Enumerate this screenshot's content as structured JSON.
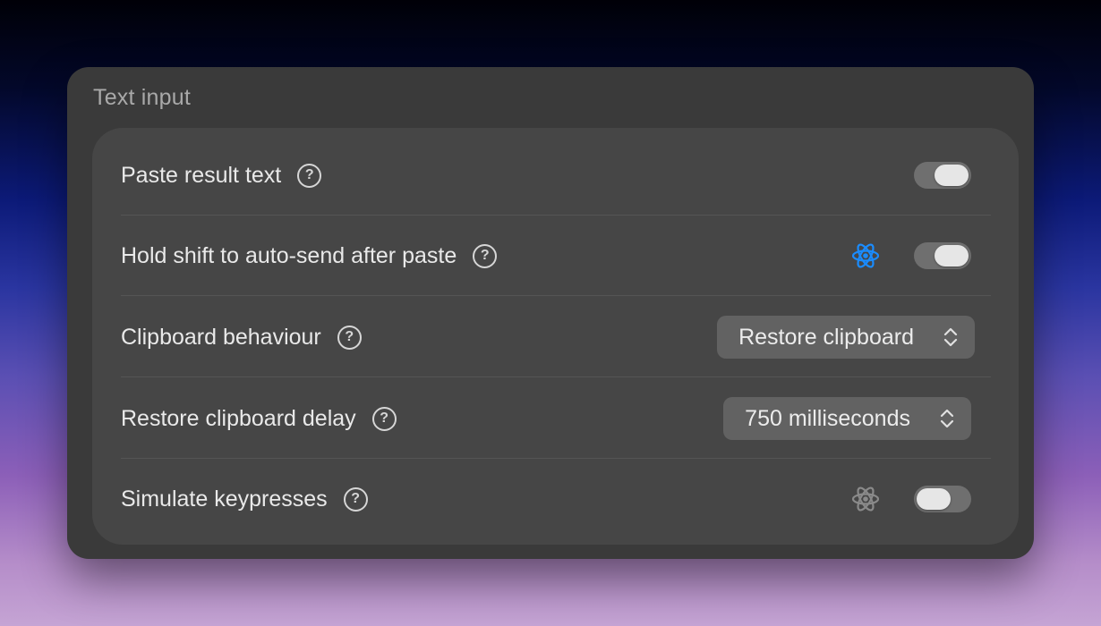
{
  "section": {
    "title": "Text input"
  },
  "rows": [
    {
      "label": "Paste result text",
      "help": "?",
      "toggle": "on"
    },
    {
      "label": "Hold shift to auto-send after paste",
      "help": "?",
      "toggle": "on",
      "badge_icon": "atom-icon",
      "badge_color": "#1a8cff"
    },
    {
      "label": "Clipboard behaviour",
      "help": "?",
      "select_value": "Restore clipboard"
    },
    {
      "label": "Restore clipboard delay",
      "help": "?",
      "select_value": "750 milliseconds"
    },
    {
      "label": "Simulate keypresses",
      "help": "?",
      "toggle": "off",
      "badge_icon": "atom-icon",
      "badge_color": "#8a8a8a"
    }
  ],
  "colors": {
    "panel": "#3a3a3a",
    "card": "#464646",
    "toggle_track": "#6f6f6f",
    "select_bg": "#626262"
  }
}
